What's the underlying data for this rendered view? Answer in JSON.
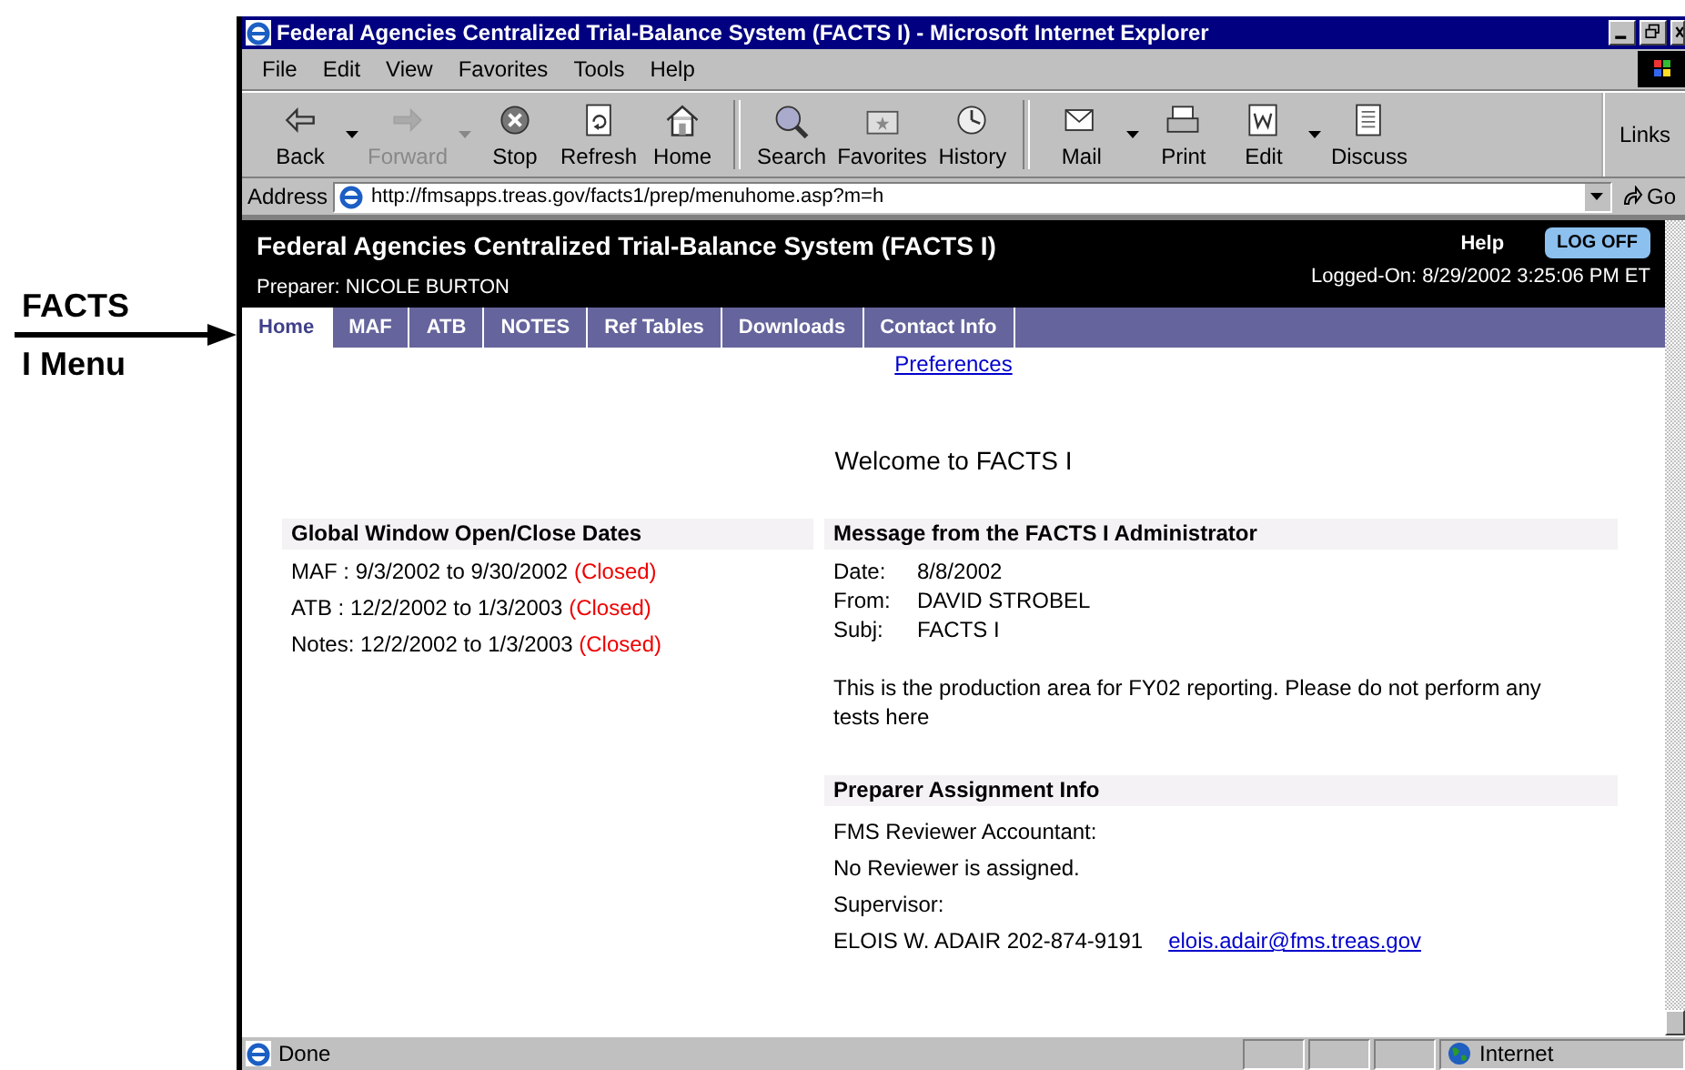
{
  "annotation": {
    "label_lines": [
      "FACTS",
      "I Menu"
    ]
  },
  "window": {
    "title": "Federal Agencies Centralized Trial-Balance System (FACTS I) - Microsoft Internet Explorer"
  },
  "menu": [
    "File",
    "Edit",
    "View",
    "Favorites",
    "Tools",
    "Help"
  ],
  "toolbar": {
    "groups": [
      [
        {
          "label": "Back",
          "kind": "back",
          "disabled": false,
          "dropdown": true
        },
        {
          "label": "Forward",
          "kind": "forward",
          "disabled": true,
          "dropdown": true
        },
        {
          "label": "Stop",
          "kind": "stop",
          "disabled": false,
          "dropdown": false
        },
        {
          "label": "Refresh",
          "kind": "refresh",
          "disabled": false,
          "dropdown": false
        },
        {
          "label": "Home",
          "kind": "home",
          "disabled": false,
          "dropdown": false
        }
      ],
      [
        {
          "label": "Search",
          "kind": "search",
          "disabled": false,
          "dropdown": false
        },
        {
          "label": "Favorites",
          "kind": "favorites",
          "disabled": false,
          "dropdown": false
        },
        {
          "label": "History",
          "kind": "history",
          "disabled": false,
          "dropdown": false
        }
      ],
      [
        {
          "label": "Mail",
          "kind": "mail",
          "disabled": false,
          "dropdown": true
        },
        {
          "label": "Print",
          "kind": "print",
          "disabled": false,
          "dropdown": false
        },
        {
          "label": "Edit",
          "kind": "edit",
          "disabled": false,
          "dropdown": true
        },
        {
          "label": "Discuss",
          "kind": "discuss",
          "disabled": false,
          "dropdown": false
        }
      ]
    ],
    "links": "Links"
  },
  "address": {
    "label": "Address",
    "value": "http://fmsapps.treas.gov/facts1/prep/menuhome.asp?m=h",
    "go": "Go"
  },
  "header": {
    "title": "Federal Agencies Centralized Trial-Balance System (FACTS I)",
    "preparer": "Preparer: NICOLE BURTON",
    "help": "Help",
    "logoff": "LOG OFF",
    "logged_on": "Logged-On: 8/29/2002 3:25:06 PM ET"
  },
  "tabs": [
    {
      "label": "Home",
      "selected": true
    },
    {
      "label": "MAF",
      "selected": false
    },
    {
      "label": "ATB",
      "selected": false
    },
    {
      "label": "NOTES",
      "selected": false
    },
    {
      "label": "Ref Tables",
      "selected": false
    },
    {
      "label": "Downloads",
      "selected": false
    },
    {
      "label": "Contact Info",
      "selected": false
    }
  ],
  "preferences_link": "Preferences",
  "welcome": "Welcome to FACTS I",
  "global_window": {
    "heading": "Global Window Open/Close Dates",
    "rows": [
      {
        "text": "MAF : 9/3/2002 to 9/30/2002",
        "status": "(Closed)"
      },
      {
        "text": "ATB : 12/2/2002 to 1/3/2003",
        "status": "(Closed)"
      },
      {
        "text": "Notes: 12/2/2002 to 1/3/2003",
        "status": "(Closed)"
      }
    ]
  },
  "message": {
    "heading": "Message from the FACTS I Administrator",
    "fields": [
      {
        "label": "Date:",
        "value": "8/8/2002"
      },
      {
        "label": "From:",
        "value": "DAVID STROBEL"
      },
      {
        "label": "Subj:",
        "value": "FACTS I"
      }
    ],
    "body": "This is the production area for FY02 reporting. Please do not perform any tests here"
  },
  "assignment": {
    "heading": "Preparer Assignment Info",
    "lines": [
      "FMS Reviewer Accountant:",
      "No Reviewer is assigned.",
      "Supervisor:"
    ],
    "supervisor": "ELOIS W. ADAIR 202-874-9191",
    "email": "elois.adair@fms.treas.gov"
  },
  "status_bar": {
    "text": "Done",
    "zone": "Internet"
  }
}
